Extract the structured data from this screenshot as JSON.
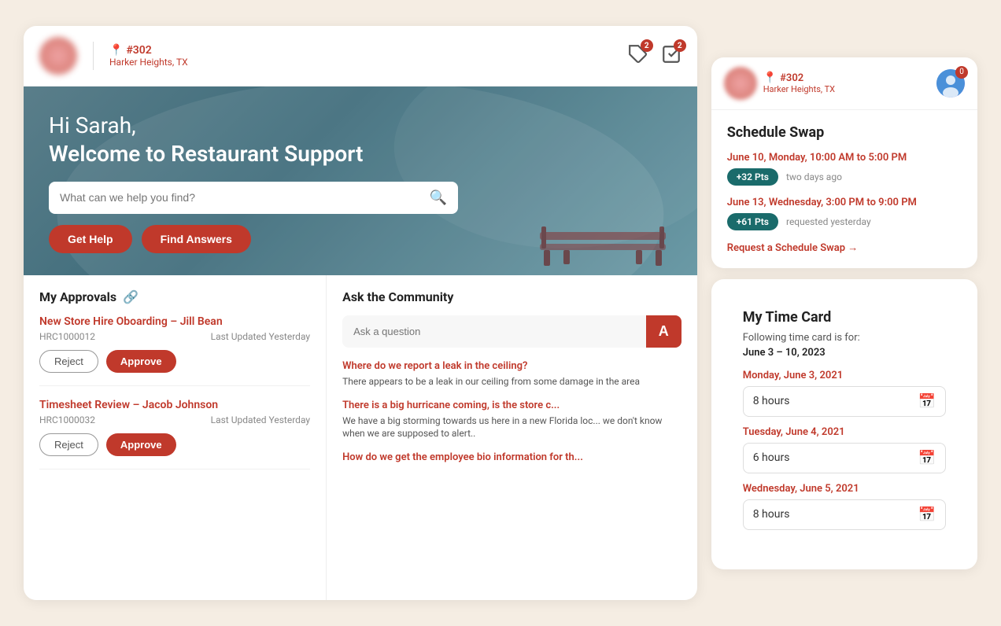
{
  "header": {
    "store_number": "#302",
    "store_location": "Harker Heights, TX",
    "tag_badge": "2",
    "checkbox_badge": "2"
  },
  "hero": {
    "greeting": "Hi Sarah,",
    "subtitle": "Welcome to Restaurant Support",
    "search_placeholder": "What can we help you find?",
    "btn_help": "Get Help",
    "btn_answers": "Find Answers"
  },
  "approvals": {
    "title": "My Approvals",
    "items": [
      {
        "title": "New Store Hire Oboarding – Jill Bean",
        "id": "HRC1000012",
        "updated": "Last Updated Yesterday",
        "reject_label": "Reject",
        "approve_label": "Approve"
      },
      {
        "title": "Timesheet Review – Jacob Johnson",
        "id": "HRC1000032",
        "updated": "Last Updated Yesterday",
        "reject_label": "Reject",
        "approve_label": "Approve"
      }
    ]
  },
  "community": {
    "title": "Ask the Community",
    "ask_placeholder": "Ask a question",
    "ask_btn": "A",
    "questions": [
      {
        "title": "Where do we report a leak in the ceiling?",
        "body": "There appears to be a leak in our ceiling from some damage in the area"
      },
      {
        "title": "There is a big hurricane coming, is the store c...",
        "body": "We have a big storming towards us here in a new Florida loc... we don't know when we are supposed to alert.."
      },
      {
        "title": "How do we get the employee bio information for th...",
        "body": ""
      }
    ]
  },
  "right_header": {
    "store_number": "#302",
    "store_location": "Harker Heights, TX",
    "notification_count": "0"
  },
  "schedule_swap": {
    "title": "Schedule Swap",
    "items": [
      {
        "date": "June 10, Monday, 10:00 AM to 5:00 PM",
        "pts": "+32 Pts",
        "time_ago": "two days ago"
      },
      {
        "date": "June 13, Wednesday, 3:00 PM to 9:00 PM",
        "pts": "+61 Pts",
        "time_ago": "requested yesterday"
      }
    ],
    "request_link": "Request a Schedule Swap →"
  },
  "time_card": {
    "title": "My Time Card",
    "desc": "Following time card is for:",
    "range": "June 3 – 10, 2023",
    "entries": [
      {
        "date": "Monday, June 3, 2021",
        "hours": "8 hours"
      },
      {
        "date": "Tuesday, June 4, 2021",
        "hours": "6 hours"
      },
      {
        "date": "Wednesday, June 5, 2021",
        "hours": "8 hours"
      }
    ]
  }
}
